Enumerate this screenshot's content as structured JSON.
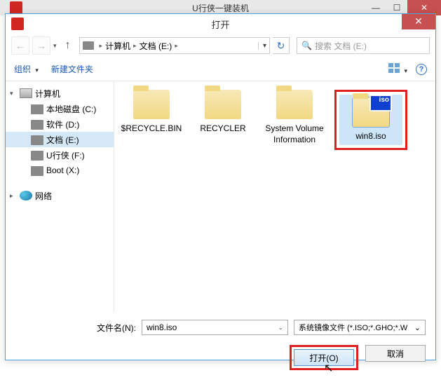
{
  "parent_window": {
    "title": "U行侠一键装机",
    "minimize": "—",
    "maximize": "☐",
    "close": "✕"
  },
  "dialog": {
    "title": "打开",
    "close": "✕",
    "nav": {
      "back": "←",
      "forward": "→",
      "dropdown": "▾",
      "up": "↑",
      "refresh": "↻"
    },
    "breadcrumb": {
      "computer": "计算机",
      "drive": "文档 (E:)",
      "sep": "▸",
      "dd": "▾"
    },
    "search": {
      "placeholder": "搜索 文档 (E:)",
      "icon": "🔍"
    },
    "toolbar": {
      "organize": "组织",
      "newfolder": "新建文件夹",
      "view_dd": "▾",
      "help": "?"
    },
    "sidebar": {
      "computer": "计算机",
      "drives": [
        {
          "label": "本地磁盘 (C:)"
        },
        {
          "label": "软件 (D:)"
        },
        {
          "label": "文档 (E:)",
          "selected": true
        },
        {
          "label": "U行侠 (F:)"
        },
        {
          "label": "Boot (X:)"
        }
      ],
      "network": "网络"
    },
    "files": [
      {
        "name": "$RECYCLE.BIN",
        "type": "folder"
      },
      {
        "name": "RECYCLER",
        "type": "folder"
      },
      {
        "name": "System Volume Information",
        "type": "folder"
      },
      {
        "name": "win8.iso",
        "type": "iso",
        "selected": true,
        "highlighted": true
      }
    ],
    "filename_label": "文件名(N):",
    "filename_value": "win8.iso",
    "filter": "系统镜像文件 (*.ISO;*.GHO;*.W",
    "open_btn": "打开(O)",
    "cancel_btn": "取消"
  }
}
